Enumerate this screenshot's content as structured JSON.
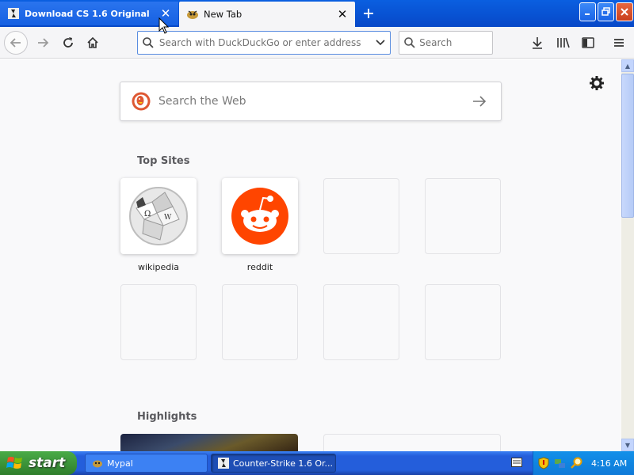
{
  "tabs": [
    {
      "title": "Download CS 1.6 Original",
      "active": false
    },
    {
      "title": "New Tab",
      "active": true
    }
  ],
  "toolbar": {
    "url_placeholder": "Search with DuckDuckGo or enter address",
    "search_placeholder": "Search"
  },
  "newtab": {
    "websearch_placeholder": "Search the Web",
    "top_sites_heading": "Top Sites",
    "highlights_heading": "Highlights",
    "top_sites": [
      {
        "label": "wikipedia",
        "icon": "wikipedia-icon"
      },
      {
        "label": "reddit",
        "icon": "reddit-icon"
      }
    ]
  },
  "taskbar": {
    "start_label": "start",
    "tasks": [
      {
        "label": "Mypal"
      },
      {
        "label": "Counter-Strike 1.6 Or..."
      }
    ],
    "clock": "4:16 AM"
  },
  "colors": {
    "titlebar": "#0a5fe0",
    "reddit": "#ff4500",
    "duckduckgo": "#de5833",
    "start_green": "#3c953a"
  }
}
